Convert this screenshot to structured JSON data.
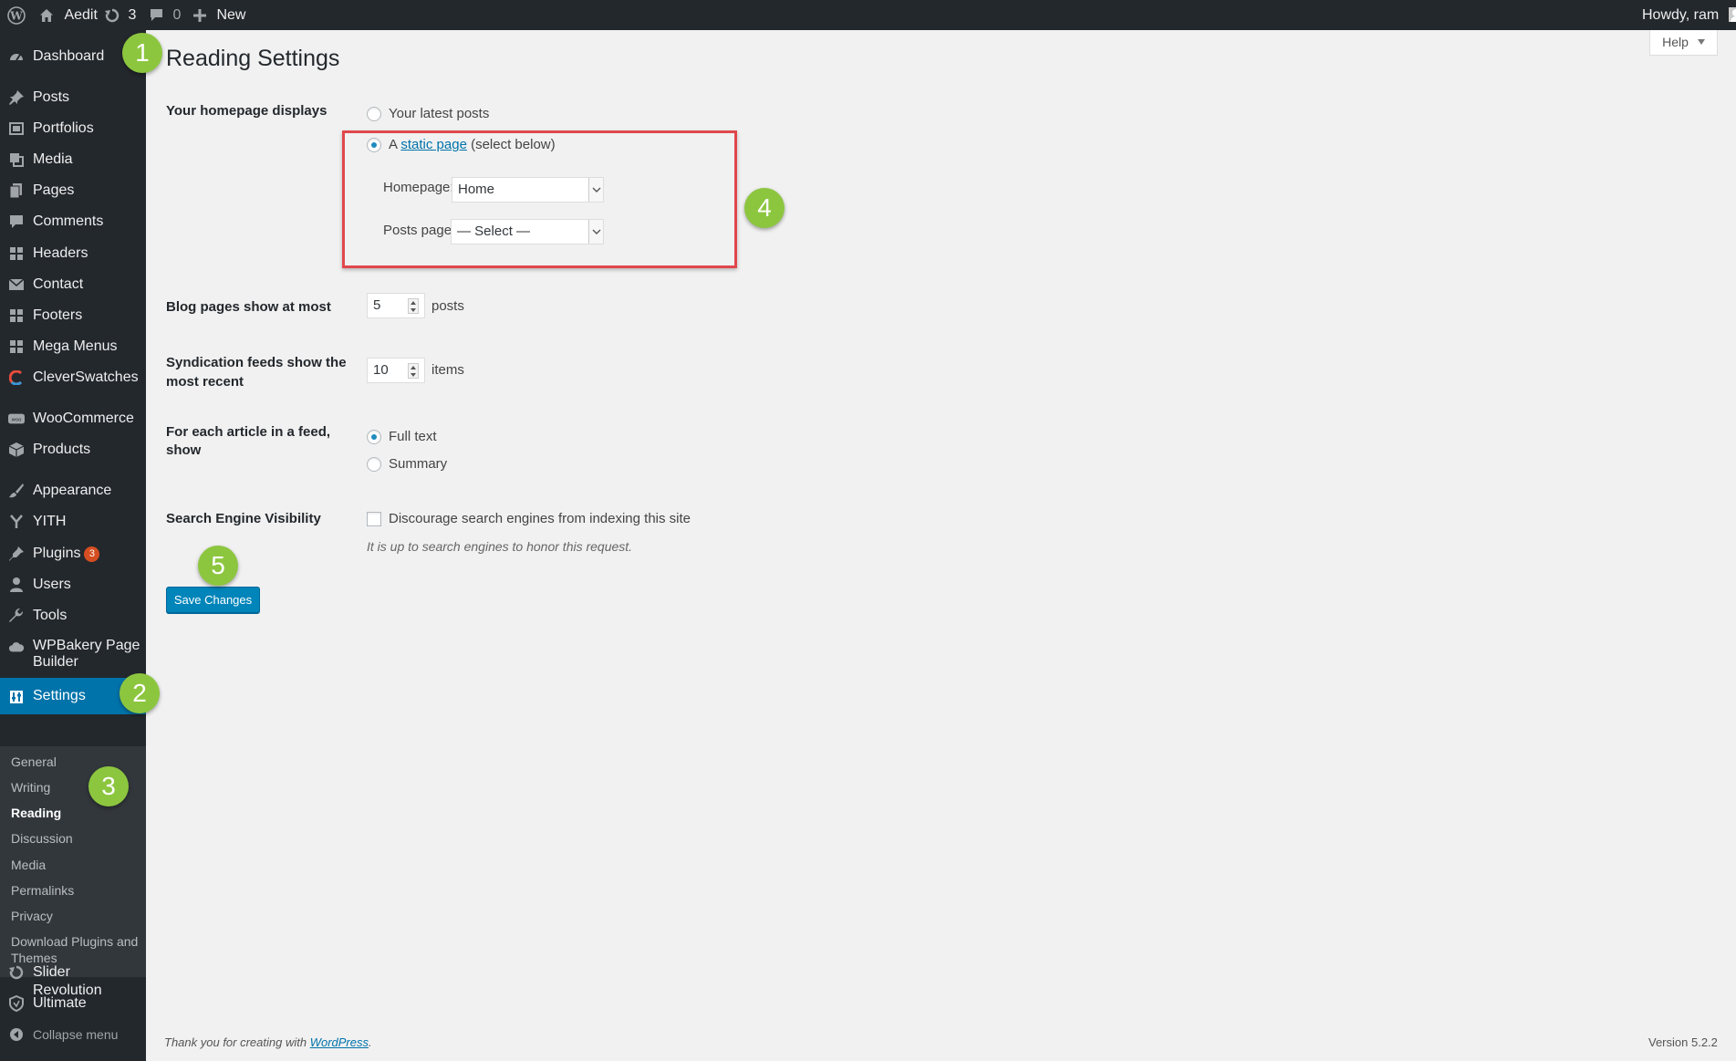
{
  "adminbar": {
    "site_name": "Aedit",
    "updates_count": "3",
    "comments_count": "0",
    "new_label": "New",
    "greeting": "Howdy, ram"
  },
  "sidebar": {
    "items": [
      {
        "label": "Dashboard",
        "icon": "dashboard-icon"
      },
      {
        "label": "Posts",
        "icon": "pin-icon"
      },
      {
        "label": "Portfolios",
        "icon": "portfolio-icon"
      },
      {
        "label": "Media",
        "icon": "media-icon"
      },
      {
        "label": "Pages",
        "icon": "pages-icon"
      },
      {
        "label": "Comments",
        "icon": "comment-icon"
      },
      {
        "label": "Headers",
        "icon": "grid-icon"
      },
      {
        "label": "Contact",
        "icon": "mail-icon"
      },
      {
        "label": "Footers",
        "icon": "grid-icon"
      },
      {
        "label": "Mega Menus",
        "icon": "grid-icon"
      },
      {
        "label": "CleverSwatches",
        "icon": "swatch-icon"
      },
      {
        "label": "WooCommerce",
        "icon": "woo-icon"
      },
      {
        "label": "Products",
        "icon": "box-icon"
      },
      {
        "label": "Appearance",
        "icon": "brush-icon"
      },
      {
        "label": "YITH",
        "icon": "yith-icon"
      },
      {
        "label": "Plugins",
        "icon": "plugin-icon",
        "badge": "3"
      },
      {
        "label": "Users",
        "icon": "user-icon"
      },
      {
        "label": "Tools",
        "icon": "wrench-icon"
      },
      {
        "label": "WPBakery Page Builder",
        "icon": "cloud-icon"
      },
      {
        "label": "Settings",
        "icon": "settings-icon"
      },
      {
        "label": "Slider Revolution",
        "icon": "refresh-icon"
      },
      {
        "label": "Ultimate",
        "icon": "shield-icon"
      },
      {
        "label": "Collapse menu",
        "icon": "collapse-icon"
      }
    ],
    "submenu": [
      "General",
      "Writing",
      "Reading",
      "Discussion",
      "Media",
      "Permalinks",
      "Privacy",
      "Download Plugins and Themes"
    ]
  },
  "help_label": "Help",
  "page_title": "Reading Settings",
  "form": {
    "homepage_displays": {
      "label": "Your homepage displays",
      "option_latest": "Your latest posts",
      "option_static_prefix": "A",
      "option_static_link": "static page",
      "option_static_suffix": "(select below)",
      "selected": "static page"
    },
    "homepage_select": {
      "label": "Homepage:",
      "value": "Home"
    },
    "posts_page_select": {
      "label": "Posts page:",
      "value": "— Select —"
    },
    "blog_pages": {
      "label": "Blog pages show at most",
      "value": "5",
      "unit": "posts"
    },
    "syndication": {
      "label": "Syndication feeds show the most recent",
      "value": "10",
      "unit": "items"
    },
    "feed_article": {
      "label": "For each article in a feed, show",
      "option_full": "Full text",
      "option_summary": "Summary",
      "selected": "Full text"
    },
    "search_visibility": {
      "label": "Search Engine Visibility",
      "checkbox_label": "Discourage search engines from indexing this site",
      "checked": false,
      "hint": "It is up to search engines to honor this request."
    },
    "save_label": "Save Changes"
  },
  "steps": [
    "1",
    "2",
    "3",
    "4",
    "5"
  ],
  "footer": {
    "thanks_prefix": "Thank you for creating with",
    "thanks_link": "WordPress",
    "thanks_suffix": ".",
    "version": "Version 5.2.2"
  },
  "colors": {
    "accent": "#0073aa",
    "button": "#0085ba",
    "step_badge": "#8cc63f",
    "highlight_border": "#e0474c",
    "sidebar_bg": "#23282d",
    "plugin_badge": "#d54e21"
  }
}
